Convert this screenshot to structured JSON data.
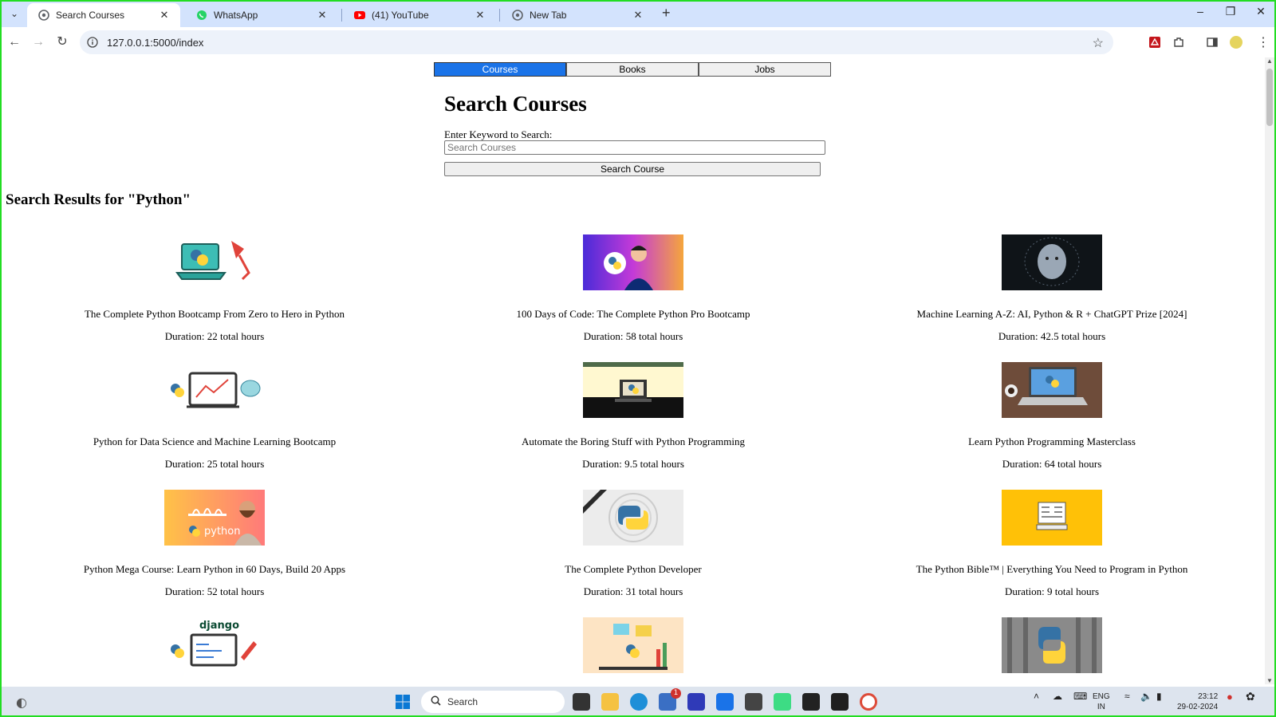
{
  "browser": {
    "tabs": [
      {
        "title": "Search Courses",
        "icon": "chrome-icon",
        "active": true
      },
      {
        "title": "WhatsApp",
        "icon": "whatsapp-icon",
        "active": false
      },
      {
        "title": "(41) YouTube",
        "icon": "youtube-icon",
        "active": false
      },
      {
        "title": "New Tab",
        "icon": "chrome-icon",
        "active": false
      }
    ],
    "url": "127.0.0.1:5000/index"
  },
  "nav": {
    "tabs": [
      {
        "label": "Courses",
        "active": true
      },
      {
        "label": "Books",
        "active": false
      },
      {
        "label": "Jobs",
        "active": false
      }
    ]
  },
  "search": {
    "heading": "Search Courses",
    "label": "Enter Keyword to Search:",
    "placeholder": "Search Courses",
    "button": "Search Course"
  },
  "results": {
    "title": "Search Results for \"Python\"",
    "courses": [
      {
        "name": "The Complete Python Bootcamp From Zero to Hero in Python",
        "duration": "Duration: 22 total hours",
        "thumb_color": "#ffffff"
      },
      {
        "name": "100 Days of Code: The Complete Python Pro Bootcamp",
        "duration": "Duration: 58 total hours",
        "thumb_color": "#6a2bd8"
      },
      {
        "name": "Machine Learning A-Z: AI, Python & R + ChatGPT Prize [2024]",
        "duration": "Duration: 42.5 total hours",
        "thumb_color": "#1a1a1a"
      },
      {
        "name": "Python for Data Science and Machine Learning Bootcamp",
        "duration": "Duration: 25 total hours",
        "thumb_color": "#ffffff"
      },
      {
        "name": "Automate the Boring Stuff with Python Programming",
        "duration": "Duration: 9.5 total hours",
        "thumb_color": "#fff8d0"
      },
      {
        "name": "Learn Python Programming Masterclass",
        "duration": "Duration: 64 total hours",
        "thumb_color": "#7a5a48"
      },
      {
        "name": "Python Mega Course: Learn Python in 60 Days, Build 20 Apps",
        "duration": "Duration: 52 total hours",
        "thumb_color": "#f7a94a"
      },
      {
        "name": "The Complete Python Developer",
        "duration": "Duration: 31 total hours",
        "thumb_color": "#eeeeee"
      },
      {
        "name": "The Python Bible™ | Everything You Need to Program in Python",
        "duration": "Duration: 9 total hours",
        "thumb_color": "#ffc107"
      },
      {
        "name": "",
        "duration": "",
        "thumb_color": "#ffffff"
      },
      {
        "name": "",
        "duration": "",
        "thumb_color": "#fde4c4"
      },
      {
        "name": "",
        "duration": "",
        "thumb_color": "#888888"
      }
    ]
  },
  "taskbar": {
    "search_placeholder": "Search",
    "lang": "ENG",
    "region": "IN",
    "time": "23:12",
    "date": "29-02-2024",
    "store_badge": "1"
  }
}
